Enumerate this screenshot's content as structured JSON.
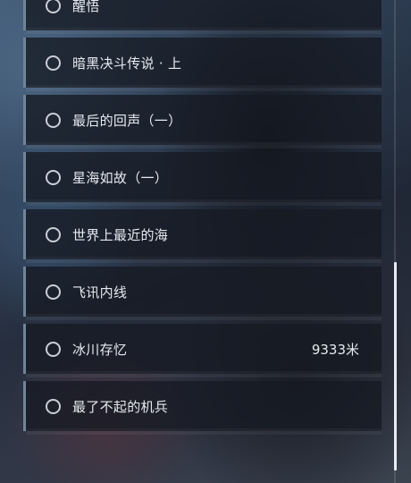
{
  "quest_list": {
    "items": [
      {
        "label": "醒悟",
        "distance": ""
      },
      {
        "label": "暗黑决斗传说 · 上",
        "distance": ""
      },
      {
        "label": "最后的回声（一）",
        "distance": ""
      },
      {
        "label": "星海如故（一）",
        "distance": ""
      },
      {
        "label": "世界上最近的海",
        "distance": ""
      },
      {
        "label": "飞讯内线",
        "distance": ""
      },
      {
        "label": "冰川存忆",
        "distance": "9333米"
      },
      {
        "label": "最了不起的机兵",
        "distance": ""
      }
    ]
  },
  "scrollbar": {
    "position": 0.55,
    "visible_fraction": 0.43
  }
}
